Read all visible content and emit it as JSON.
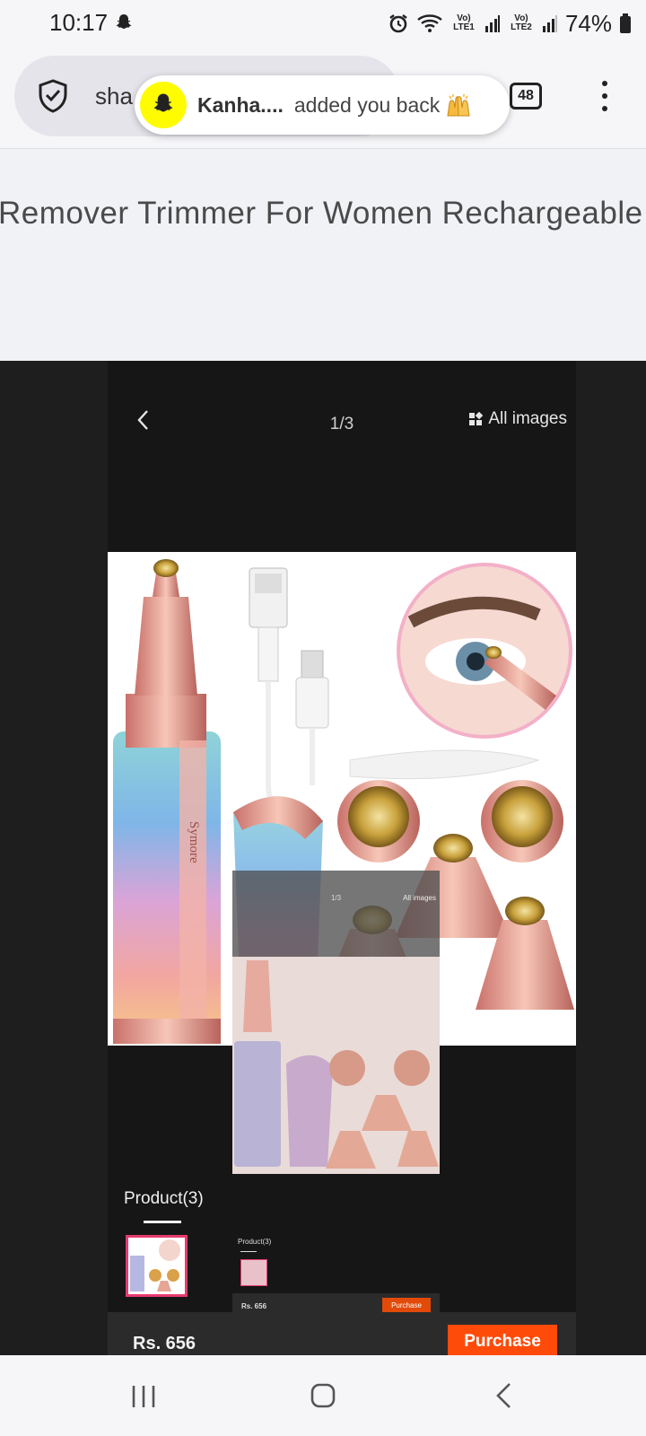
{
  "status_bar": {
    "time": "10:17",
    "lte1": "Vo) LTE1",
    "lte2": "Vo) LTE2",
    "battery": "74%"
  },
  "browser": {
    "url_partial": "sha",
    "tab_count": "48",
    "icons": [
      "shield-check-icon",
      "tabs-icon",
      "more-vert-icon"
    ]
  },
  "notification": {
    "sender": "Kanha....",
    "message": "added you back",
    "emoji": "raising-hands-emoji",
    "app_color": "#fffc00"
  },
  "page": {
    "title": "Remover Trimmer For Women Rechargeable"
  },
  "viewer": {
    "counter": "1/3",
    "all_images_label": "All images",
    "brand_on_device": "Symore",
    "product_tab_label": "Product(3)",
    "price": "Rs. 656",
    "purchase_label": "Purchase",
    "purchase_color": "#ff4b0a"
  }
}
